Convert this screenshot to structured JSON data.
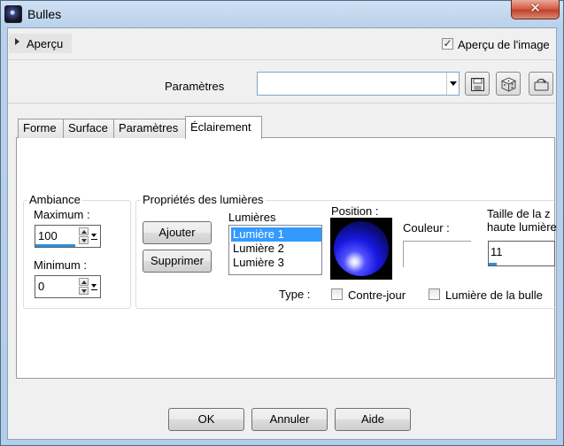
{
  "window": {
    "title": "Bulles",
    "close_glyph": "✕"
  },
  "preview": {
    "toggle_label": "Aperçu",
    "image_preview_label": "Aperçu de l'image",
    "image_preview_checked": true
  },
  "presets": {
    "label": "Paramètres",
    "value": ""
  },
  "tabs": [
    {
      "label": "Forme",
      "active": false
    },
    {
      "label": "Surface",
      "active": false
    },
    {
      "label": "Paramètres",
      "active": false
    },
    {
      "label": "Éclairement",
      "active": true
    }
  ],
  "ambiance": {
    "title": "Ambiance",
    "maximum_label": "Maximum :",
    "maximum_value": "100",
    "minimum_label": "Minimum :",
    "minimum_value": "0"
  },
  "lights": {
    "group_title": "Propriétés des lumières",
    "add_button": "Ajouter",
    "delete_button": "Supprimer",
    "list_label": "Lumières",
    "items": [
      "Lumière 1",
      "Lumière 2",
      "Lumière 3"
    ],
    "selected_index": 0,
    "position_label": "Position :",
    "color_label": "Couleur :",
    "highlight_size_label_line1": "Taille de la z",
    "highlight_size_label_line2": "haute lumière",
    "highlight_size_value": "11",
    "type_label": "Type :",
    "backlight_label": "Contre-jour",
    "backlight_checked": false,
    "bubble_light_label": "Lumière de la bulle",
    "bubble_light_checked": false
  },
  "footer": {
    "ok": "OK",
    "cancel": "Annuler",
    "help": "Aide"
  },
  "icons": {
    "save": "save-icon",
    "randomize": "dice-icon",
    "reset": "reset-icon"
  }
}
